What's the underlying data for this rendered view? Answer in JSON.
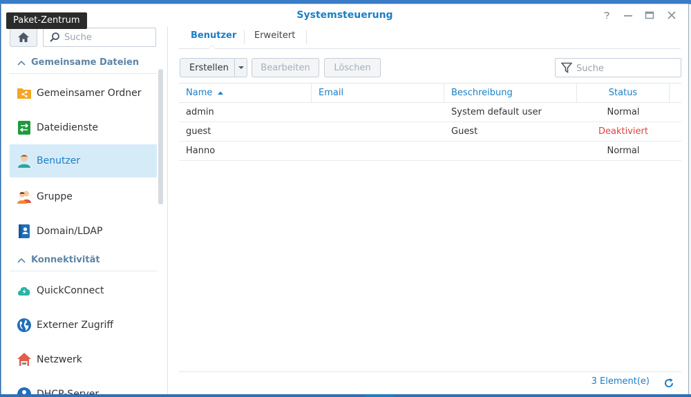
{
  "tooltip": "Paket-Zentrum",
  "window": {
    "title": "Systemsteuerung",
    "controls": [
      "help-icon",
      "minimize-icon",
      "maximize-icon",
      "close-icon"
    ]
  },
  "sidebar": {
    "search_placeholder": "Suche",
    "sections": [
      {
        "title": "Gemeinsame Dateien",
        "items": [
          {
            "label": "Gemeinsamer Ordner",
            "icon": "shared-folder-icon"
          },
          {
            "label": "Dateidienste",
            "icon": "file-services-icon"
          },
          {
            "label": "Benutzer",
            "icon": "user-icon",
            "active": true
          },
          {
            "label": "Gruppe",
            "icon": "group-icon"
          },
          {
            "label": "Domain/LDAP",
            "icon": "domain-ldap-icon"
          }
        ]
      },
      {
        "title": "Konnektivität",
        "items": [
          {
            "label": "QuickConnect",
            "icon": "quickconnect-icon"
          },
          {
            "label": "Externer Zugriff",
            "icon": "external-access-icon"
          },
          {
            "label": "Netzwerk",
            "icon": "network-icon"
          },
          {
            "label": "DHCP-Server",
            "icon": "dhcp-server-icon"
          }
        ]
      }
    ]
  },
  "main": {
    "tabs": [
      {
        "label": "Benutzer",
        "active": true
      },
      {
        "label": "Erweitert",
        "active": false
      }
    ],
    "toolbar": {
      "create": "Erstellen",
      "edit": "Bearbeiten",
      "delete": "Löschen",
      "search_placeholder": "Suche"
    },
    "table": {
      "columns": [
        "Name",
        "Email",
        "Beschreibung",
        "Status"
      ],
      "sort": {
        "column": "Name",
        "direction": "asc"
      },
      "rows": [
        {
          "name": "admin",
          "email": "",
          "description": "System default user",
          "status": "Normal"
        },
        {
          "name": "guest",
          "email": "",
          "description": "Guest",
          "status": "Deaktiviert"
        },
        {
          "name": "Hanno",
          "email": "",
          "description": "",
          "status": "Normal"
        }
      ]
    },
    "footer": {
      "count": "3 Element(e)"
    }
  },
  "colors": {
    "accent": "#1a7fc6",
    "status_disabled": "#e0443e",
    "active_item_bg": "#d6ebf8"
  }
}
